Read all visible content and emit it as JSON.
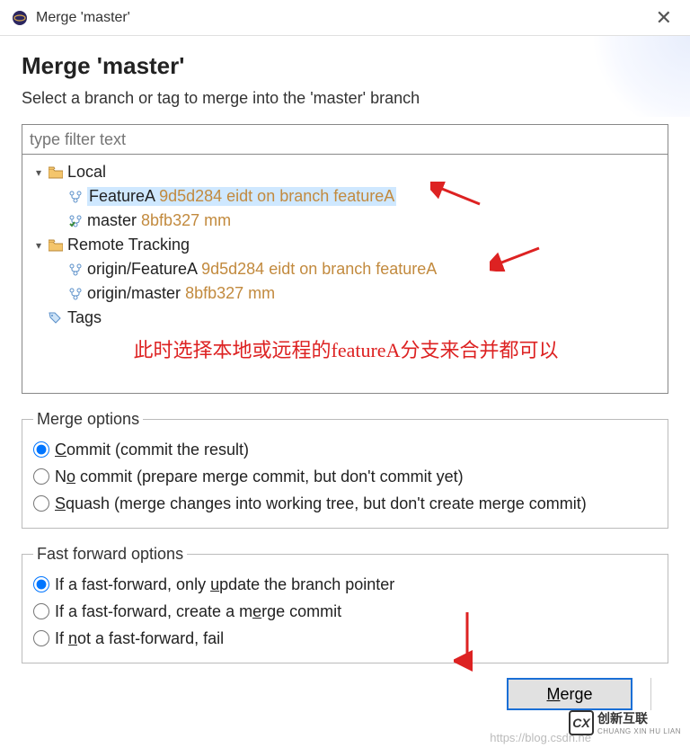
{
  "window": {
    "title": "Merge 'master'"
  },
  "header": {
    "title": "Merge 'master'",
    "subtitle": "Select a branch or tag to merge into the 'master' branch"
  },
  "filter": {
    "placeholder": "type filter text"
  },
  "tree": {
    "local": {
      "label": "Local",
      "items": [
        {
          "name": "FeatureA",
          "hash": "9d5d284",
          "msg": "eidt on branch featureA",
          "selected": true
        },
        {
          "name": "master",
          "hash": "8bfb327",
          "msg": "mm",
          "checkedout": true
        }
      ]
    },
    "remote": {
      "label": "Remote Tracking",
      "items": [
        {
          "name": "origin/FeatureA",
          "hash": "9d5d284",
          "msg": "eidt on branch featureA"
        },
        {
          "name": "origin/master",
          "hash": "8bfb327",
          "msg": "mm"
        }
      ]
    },
    "tags": {
      "label": "Tags"
    }
  },
  "annotation": "此时选择本地或远程的featureA分支来合并都可以",
  "merge_options": {
    "legend": "Merge options",
    "commit": "ommit (commit the result)",
    "nocommit": "o commit (prepare merge commit, but don't commit yet)",
    "squash": "quash (merge changes into working tree, but don't create merge commit)"
  },
  "ff_options": {
    "legend": "Fast forward options",
    "update": "pdate the branch pointer",
    "update_prefix": "If a fast-forward, only ",
    "mergecommit": "rge commit",
    "mergecommit_prefix": "If a fast-forward, create a m",
    "fail_prefix": "If ",
    "fail_mid": "ot a fast-forward, fail"
  },
  "buttons": {
    "merge": "erge"
  },
  "watermark": {
    "text": "创新互联",
    "sub": "CHUANG XIN HU LIAN",
    "url": "https://blog.csdn.ne"
  }
}
